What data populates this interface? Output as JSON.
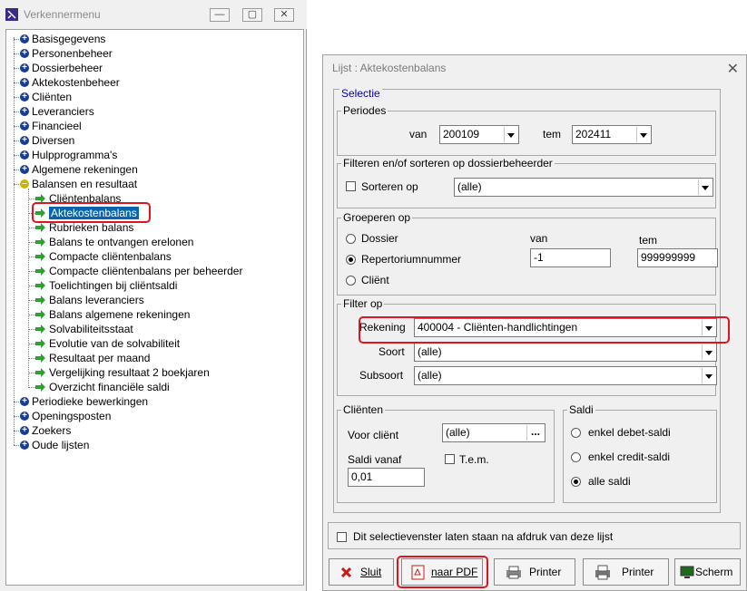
{
  "left_window": {
    "title": "Verkennermenu",
    "controls": {
      "minimize": "—",
      "maximize": "▢",
      "close": "✕"
    },
    "tree": [
      {
        "label": "Basisgegevens",
        "type": "plus"
      },
      {
        "label": "Personenbeheer",
        "type": "plus"
      },
      {
        "label": "Dossierbeheer",
        "type": "plus"
      },
      {
        "label": "Aktekostenbeheer",
        "type": "plus"
      },
      {
        "label": "Cliënten",
        "type": "plus"
      },
      {
        "label": "Leveranciers",
        "type": "plus"
      },
      {
        "label": "Financieel",
        "type": "plus"
      },
      {
        "label": "Diversen",
        "type": "plus"
      },
      {
        "label": "Hulpprogramma's",
        "type": "plus"
      },
      {
        "label": "Algemene rekeningen",
        "type": "plus"
      },
      {
        "label": "Balansen en resultaat",
        "type": "minus"
      },
      {
        "label": "Cliëntenbalans",
        "type": "child"
      },
      {
        "label": "Aktekostenbalans",
        "type": "child",
        "selected": true
      },
      {
        "label": "Rubrieken balans",
        "type": "child"
      },
      {
        "label": "Balans te ontvangen erelonen",
        "type": "child"
      },
      {
        "label": "Compacte cliëntenbalans",
        "type": "child"
      },
      {
        "label": "Compacte cliëntenbalans per beheerder",
        "type": "child"
      },
      {
        "label": "Toelichtingen bij cliëntsaldi",
        "type": "child"
      },
      {
        "label": "Balans leveranciers",
        "type": "child"
      },
      {
        "label": "Balans algemene rekeningen",
        "type": "child"
      },
      {
        "label": "Solvabiliteitsstaat",
        "type": "child"
      },
      {
        "label": "Evolutie van de solvabiliteit",
        "type": "child"
      },
      {
        "label": "Resultaat per maand",
        "type": "child"
      },
      {
        "label": "Vergelijking resultaat 2 boekjaren",
        "type": "child"
      },
      {
        "label": "Overzicht financiële saldi",
        "type": "child"
      },
      {
        "label": "Periodieke bewerkingen",
        "type": "plus"
      },
      {
        "label": "Openingsposten",
        "type": "plus"
      },
      {
        "label": "Zoekers",
        "type": "plus"
      },
      {
        "label": "Oude lijsten",
        "type": "plus"
      }
    ]
  },
  "dialog": {
    "title": "Lijst : Aktekostenbalans",
    "close": "✕",
    "selectie_label": "Selectie",
    "periodes": {
      "label": "Periodes",
      "van_label": "van",
      "van_value": "200109",
      "tem_label": "tem",
      "tem_value": "202411"
    },
    "filter_sort": {
      "label": "Filteren en/of sorteren op dossierbeheerder",
      "sort_label": "Sorteren op",
      "sort_value": "(alle)"
    },
    "groeperen": {
      "label": "Groeperen op",
      "options": [
        "Dossier",
        "Repertoriumnummer",
        "Cliënt"
      ],
      "selected": "Repertoriumnummer",
      "van_label": "van",
      "van_value": "-1",
      "tem_label": "tem",
      "tem_value": "999999999"
    },
    "filter_op": {
      "label": "Filter op",
      "rekening_label": "Rekening",
      "rekening_value": "400004 - Cliënten-handlichtingen",
      "soort_label": "Soort",
      "soort_value": "(alle)",
      "subsoort_label": "Subsoort",
      "subsoort_value": "(alle)"
    },
    "clienten": {
      "label": "Cliënten",
      "voor_client_label": "Voor cliënt",
      "voor_client_value": "(alle)",
      "browse": "...",
      "saldi_vanaf_label": "Saldi vanaf",
      "saldi_vanaf_value": "0,01",
      "tem_label": "T.e.m."
    },
    "saldi": {
      "label": "Saldi",
      "options": [
        "enkel debet-saldi",
        "enkel credit-saldi",
        "alle saldi"
      ],
      "selected": "alle saldi"
    },
    "keep_open_label": "Dit selectievenster laten staan na afdruk van deze lijst",
    "buttons": {
      "sluit": "Sluit",
      "pdf": "naar PDF",
      "printer1": "Printer",
      "printer2": "Printer",
      "scherm": "Scherm"
    }
  },
  "colors": {
    "highlight": "#e0141e",
    "selection": "#0a64ad",
    "plus_icon": "#1c3d8c",
    "arrow_icon": "#2aa52a",
    "link_label": "#0000cc"
  }
}
